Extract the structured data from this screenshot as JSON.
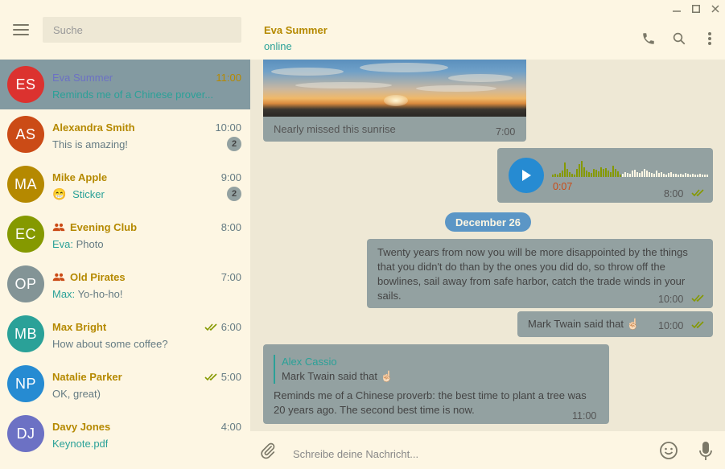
{
  "window_controls": {
    "minimize": "—",
    "maximize": "☐",
    "close": "✕"
  },
  "search": {
    "placeholder": "Suche"
  },
  "chats": [
    {
      "initials": "ES",
      "avatar_color": "#dc322f",
      "name": "Eva Summer",
      "time": "11:00",
      "preview": "Reminds me of a Chinese prover...",
      "active": true
    },
    {
      "initials": "AS",
      "avatar_color": "#cb4b16",
      "name": "Alexandra Smith",
      "time": "10:00",
      "preview": "This is amazing!",
      "badge": "2"
    },
    {
      "initials": "MA",
      "avatar_color": "#b58900",
      "name": "Mike Apple",
      "time": "9:00",
      "preview_emoji": "😁",
      "preview": "Sticker",
      "badge": "2"
    },
    {
      "initials": "EC",
      "avatar_color": "#859900",
      "name": "Evening Club",
      "group": true,
      "time": "8:00",
      "sender": "Eva:",
      "preview": "Photo"
    },
    {
      "initials": "OP",
      "avatar_color": "#839496",
      "name": "Old Pirates",
      "group": true,
      "time": "7:00",
      "sender": "Max:",
      "preview": "Yo-ho-ho!"
    },
    {
      "initials": "MB",
      "avatar_color": "#2aa198",
      "name": "Max Bright",
      "time": "6:00",
      "read": true,
      "preview": "How about some coffee?"
    },
    {
      "initials": "NP",
      "avatar_color": "#268bd2",
      "name": "Natalie Parker",
      "time": "5:00",
      "read": true,
      "preview": "OK, great)"
    },
    {
      "initials": "DJ",
      "avatar_color": "#6c71c4",
      "name": "Davy Jones",
      "time": "4:00",
      "preview": "Keynote.pdf"
    }
  ],
  "header": {
    "peer_name": "Eva Summer",
    "status": "online"
  },
  "messages": {
    "photo": {
      "caption": "Nearly missed this sunrise",
      "time": "7:00"
    },
    "voice": {
      "duration": "0:07",
      "time": "8:00"
    },
    "date": "December 26",
    "quote": {
      "text": "Twenty years from now you will be more disappointed by the things that you didn't do than by the ones you did do, so throw off the bowlines, sail away from safe harbor, catch the trade winds in your sails.",
      "time": "10:00"
    },
    "twain": {
      "text": "Mark Twain said that",
      "emoji": "☝🏻",
      "time": "10:00"
    },
    "reply": {
      "reply_name": "Alex Cassio",
      "reply_text": "Mark Twain said that",
      "reply_emoji": "☝🏻",
      "text": "Reminds me of a Chinese proverb: the best time to plant a tree was 20 years ago. The second best time is now.",
      "time": "11:00"
    }
  },
  "composer": {
    "placeholder": "Schreibe deine Nachricht..."
  },
  "colors": {
    "bg": "#fdf6e3",
    "chat_bg": "#eee8d5",
    "bubble": "#93a1a1",
    "accent": "#2aa198",
    "name": "#b58900",
    "active_row": "#839aa1"
  }
}
